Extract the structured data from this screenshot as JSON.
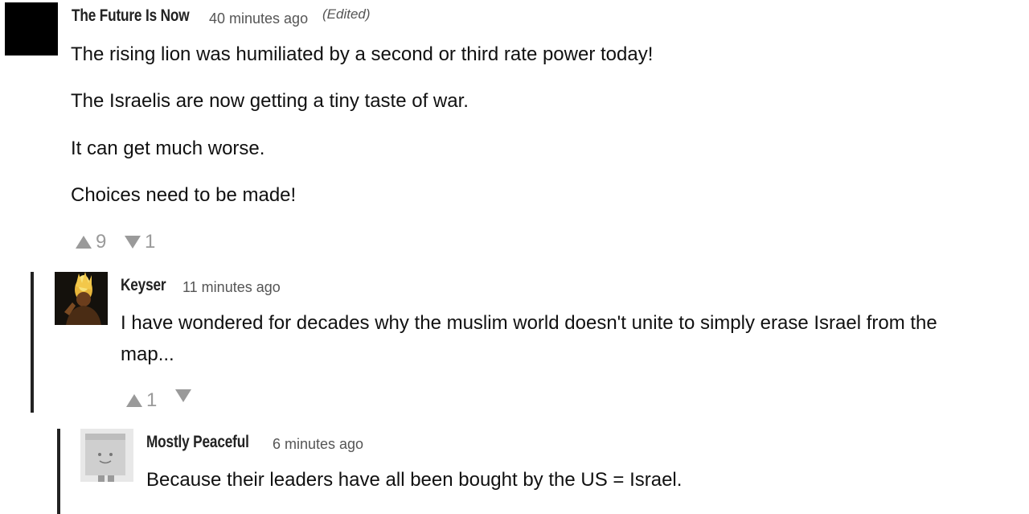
{
  "comments": [
    {
      "author": "The Future Is Now",
      "time": "40 minutes ago",
      "edited": "(Edited)",
      "paragraphs": [
        "The rising lion was humiliated by a second or third rate power today!",
        "The Israelis are now getting a tiny taste of war.",
        "It can get much worse.",
        "Choices need to be made!"
      ],
      "upvotes": "9",
      "downvotes": "1",
      "avatar": "black-square-avatar"
    },
    {
      "author": "Keyser",
      "time": "11 minutes ago",
      "paragraphs": [
        "I have wondered for decades why the muslim world doesn't unite to simply erase Israel from the",
        "map..."
      ],
      "upvotes": "1",
      "downvotes": "",
      "avatar": "flaming-figure-avatar"
    },
    {
      "author": "Mostly Peaceful",
      "time": "6 minutes ago",
      "paragraphs": [
        "Because their leaders have all been bought by the US = Israel."
      ],
      "avatar": "paper-bag-avatar"
    }
  ],
  "colors": {
    "vote_gray": "#9a9a9a",
    "thread_bar": "#222222",
    "text": "#111111",
    "meta": "#555555"
  },
  "icons": {
    "upvote": "triangle-up-icon",
    "downvote": "triangle-down-icon"
  }
}
